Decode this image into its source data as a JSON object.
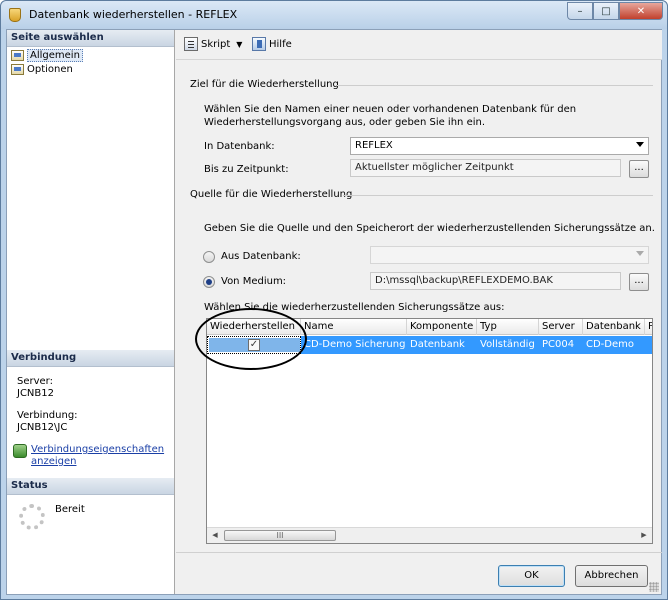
{
  "window": {
    "title": "Datenbank wiederherstellen - REFLEX",
    "controls": {
      "minimize": "–",
      "maximize": "□",
      "close": "✕"
    }
  },
  "left_pane": {
    "pages_header": "Seite auswählen",
    "pages": [
      {
        "label": "Allgemein",
        "selected": true
      },
      {
        "label": "Optionen",
        "selected": false
      }
    ],
    "connection_header": "Verbindung",
    "server_label": "Server:",
    "server_value": "JCNB12",
    "connection_label": "Verbindung:",
    "connection_value": "JCNB12\\JC",
    "properties_link_line1": "Verbindungseigenschaften",
    "properties_link_line2": "anzeigen",
    "status_header": "Status",
    "status_value": "Bereit"
  },
  "toolbar": {
    "script_label": "Skript",
    "help_label": "Hilfe"
  },
  "destination": {
    "group_title": "Ziel für die Wiederherstellung",
    "description_line1": "Wählen Sie den Namen einer neuen oder vorhandenen Datenbank für den",
    "description_line2": "Wiederherstellungsvorgang aus, oder geben Sie ihn ein.",
    "database_label": "In Datenbank:",
    "database_value": "REFLEX",
    "point_in_time_label": "Bis zu Zeitpunkt:",
    "point_in_time_value": "Aktuellster möglicher Zeitpunkt",
    "ellipsis": "..."
  },
  "source": {
    "group_title": "Quelle für die Wiederherstellung",
    "description": "Geben Sie die Quelle und den Speicherort der wiederherzustellenden Sicherungssätze an.",
    "from_database_label": "Aus Datenbank:",
    "from_database_value": "",
    "from_device_label": "Von Medium:",
    "from_device_value": "D:\\mssql\\backup\\REFLEXDEMO.BAK",
    "selected_option": "from_device",
    "ellipsis": "..."
  },
  "backup_sets": {
    "label": "Wählen Sie die wiederherzustellenden Sicherungssätze aus:",
    "columns": [
      "Wiederherstellen",
      "Name",
      "Komponente",
      "Typ",
      "Server",
      "Datenbank",
      "P"
    ],
    "rows": [
      {
        "restore": true,
        "name": "CD-Demo Sicherung",
        "component": "Datenbank",
        "type": "Vollständig",
        "server": "PC004",
        "database": "CD-Demo",
        "extra": ""
      }
    ],
    "checkmark": "✓",
    "scroll_left": "◀",
    "scroll_right": "▶",
    "thumb_grip": "III"
  },
  "buttons": {
    "ok": "OK",
    "cancel": "Abbrechen"
  }
}
